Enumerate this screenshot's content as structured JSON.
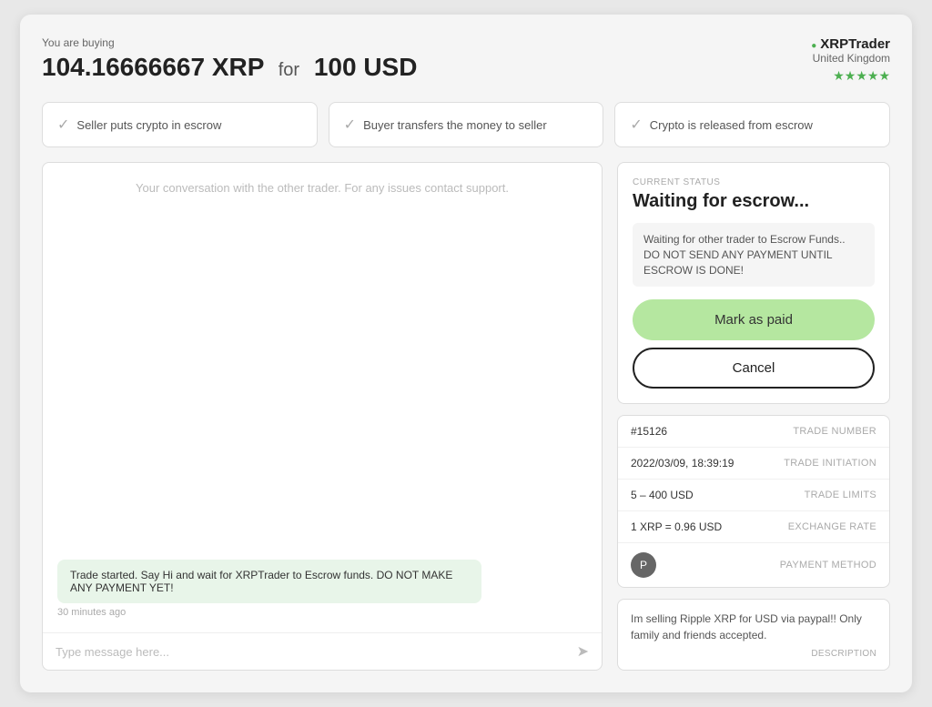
{
  "header": {
    "buying_label": "You are buying",
    "amount": "104.16666667 XRP",
    "for_text": "for",
    "fiat_amount": "100 USD"
  },
  "trader": {
    "name": "XRPTrader",
    "location": "United Kingdom",
    "stars": "★★★★★"
  },
  "steps": [
    {
      "label": "Seller puts crypto in escrow"
    },
    {
      "label": "Buyer transfers the money to seller"
    },
    {
      "label": "Crypto is released from escrow"
    }
  ],
  "chat": {
    "placeholder": "Your conversation with the other trader. For any issues contact support.",
    "system_message": "Trade started. Say Hi and wait for XRPTrader to Escrow funds. DO NOT MAKE ANY PAYMENT YET!",
    "message_time": "30 minutes ago",
    "input_placeholder": "Type message here..."
  },
  "status": {
    "current_label": "CURRENT STATUS",
    "heading": "Waiting for escrow...",
    "warning": "Waiting for other trader to Escrow Funds.. DO NOT SEND ANY PAYMENT UNTIL ESCROW IS DONE!",
    "mark_paid_btn": "Mark as paid",
    "cancel_btn": "Cancel"
  },
  "trade_details": [
    {
      "value": "#15126",
      "label": "TRADE NUMBER"
    },
    {
      "value": "2022/03/09, 18:39:19",
      "label": "TRADE INITIATION"
    },
    {
      "value": "5 – 400 USD",
      "label": "TRADE LIMITS"
    },
    {
      "value": "1 XRP = 0.96 USD",
      "label": "EXCHANGE RATE"
    }
  ],
  "payment_method_label": "PAYMENT METHOD",
  "description": {
    "text": "Im selling Ripple XRP for USD via paypal!! Only family and friends accepted.",
    "label": "DESCRIPTION"
  }
}
